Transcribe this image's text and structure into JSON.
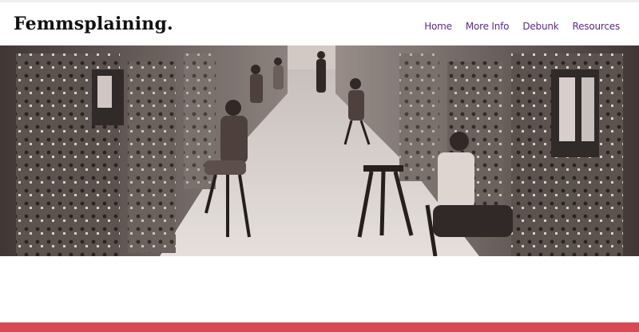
{
  "site": {
    "brand": "Femmsplaining."
  },
  "nav": {
    "items": [
      {
        "label": "Home"
      },
      {
        "label": "More Info"
      },
      {
        "label": "Debunk"
      },
      {
        "label": "Resources"
      }
    ]
  },
  "colors": {
    "brand_text": "#111111",
    "nav_text": "#5b2a86",
    "footer_accent": "#d64a55",
    "hero_tint": "#4a4442"
  },
  "hero": {
    "image": "sepia photo of women operating control panels in a long room"
  }
}
